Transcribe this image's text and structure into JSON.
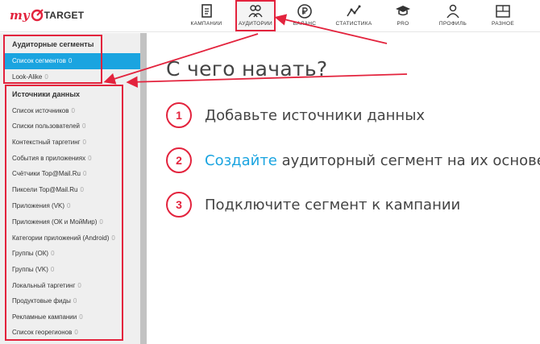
{
  "header": {
    "logo": {
      "prefix": "my",
      "name": "TARGET"
    },
    "nav": [
      {
        "label": "КАМПАНИИ",
        "icon": "campaigns-icon"
      },
      {
        "label": "АУДИТОРИИ",
        "icon": "audiences-icon",
        "active": true
      },
      {
        "label": "БАЛАНС",
        "icon": "ruble-icon"
      },
      {
        "label": "СТАТИСТИКА",
        "icon": "stats-icon"
      },
      {
        "label": "PRO",
        "icon": "graduation-cap-icon"
      },
      {
        "label": "ПРОФИЛЬ",
        "icon": "profile-icon"
      },
      {
        "label": "РАЗНОЕ",
        "icon": "misc-icon"
      }
    ]
  },
  "sidebar": {
    "audience_section": {
      "title": "Аудиторные сегменты",
      "items": [
        {
          "label": "Список сегментов",
          "count": "0",
          "active": true
        },
        {
          "label": "Look-Alike",
          "count": "0"
        }
      ]
    },
    "sources_section": {
      "title": "Источники данных",
      "items": [
        {
          "label": "Список источников",
          "count": "0"
        },
        {
          "label": "Списки пользователей",
          "count": "0"
        },
        {
          "label": "Контекстный таргетинг",
          "count": "0"
        },
        {
          "label": "События в приложениях",
          "count": "0"
        },
        {
          "label": "Счётчики Top@Mail.Ru",
          "count": "0"
        },
        {
          "label": "Пиксели Top@Mail.Ru",
          "count": "0"
        },
        {
          "label": "Приложения (VK)",
          "count": "0"
        },
        {
          "label": "Приложения (ОК и МойМир)",
          "count": "0"
        },
        {
          "label": "Категории приложений (Android)",
          "count": "0"
        },
        {
          "label": "Группы (ОК)",
          "count": "0"
        },
        {
          "label": "Группы (VK)",
          "count": "0"
        },
        {
          "label": "Локальный таргетинг",
          "count": "0"
        },
        {
          "label": "Продуктовые фиды",
          "count": "0"
        },
        {
          "label": "Рекламные кампании",
          "count": "0"
        },
        {
          "label": "Список георегионов",
          "count": "0"
        }
      ]
    }
  },
  "main": {
    "title": "С чего начать?",
    "steps": [
      {
        "number": "1",
        "text": "Добавьте источники данных"
      },
      {
        "number": "2",
        "link": "Создайте",
        "text": " аудиторный сегмент на их основе"
      },
      {
        "number": "3",
        "text": "Подключите сегмент к кампании"
      }
    ]
  },
  "colors": {
    "brand_red": "#e3233d",
    "accent_blue": "#1aa4e0",
    "sidebar_bg": "#efefef",
    "annotation_red": "#e3233d"
  }
}
